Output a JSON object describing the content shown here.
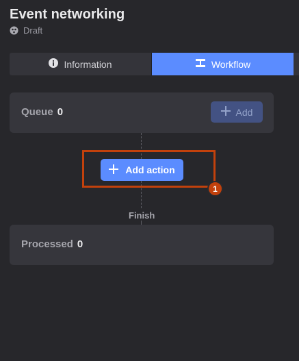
{
  "header": {
    "title": "Event networking",
    "status": "Draft",
    "status_icon": "draft-status-icon"
  },
  "tabs": [
    {
      "label": "Information",
      "icon": "info-icon",
      "active": false
    },
    {
      "label": "Workflow",
      "icon": "workflow-icon",
      "active": true
    }
  ],
  "queue": {
    "label": "Queue",
    "count": "0",
    "add_label": "Add",
    "add_icon": "plus-icon"
  },
  "workflow": {
    "add_action_label": "Add action",
    "finish_label": "Finish"
  },
  "processed": {
    "label": "Processed",
    "count": "0"
  },
  "annotation": {
    "badge": "1"
  },
  "colors": {
    "background": "#27272b",
    "accent": "#5b8cff",
    "highlight": "#c2410c",
    "card": "#36363c"
  }
}
